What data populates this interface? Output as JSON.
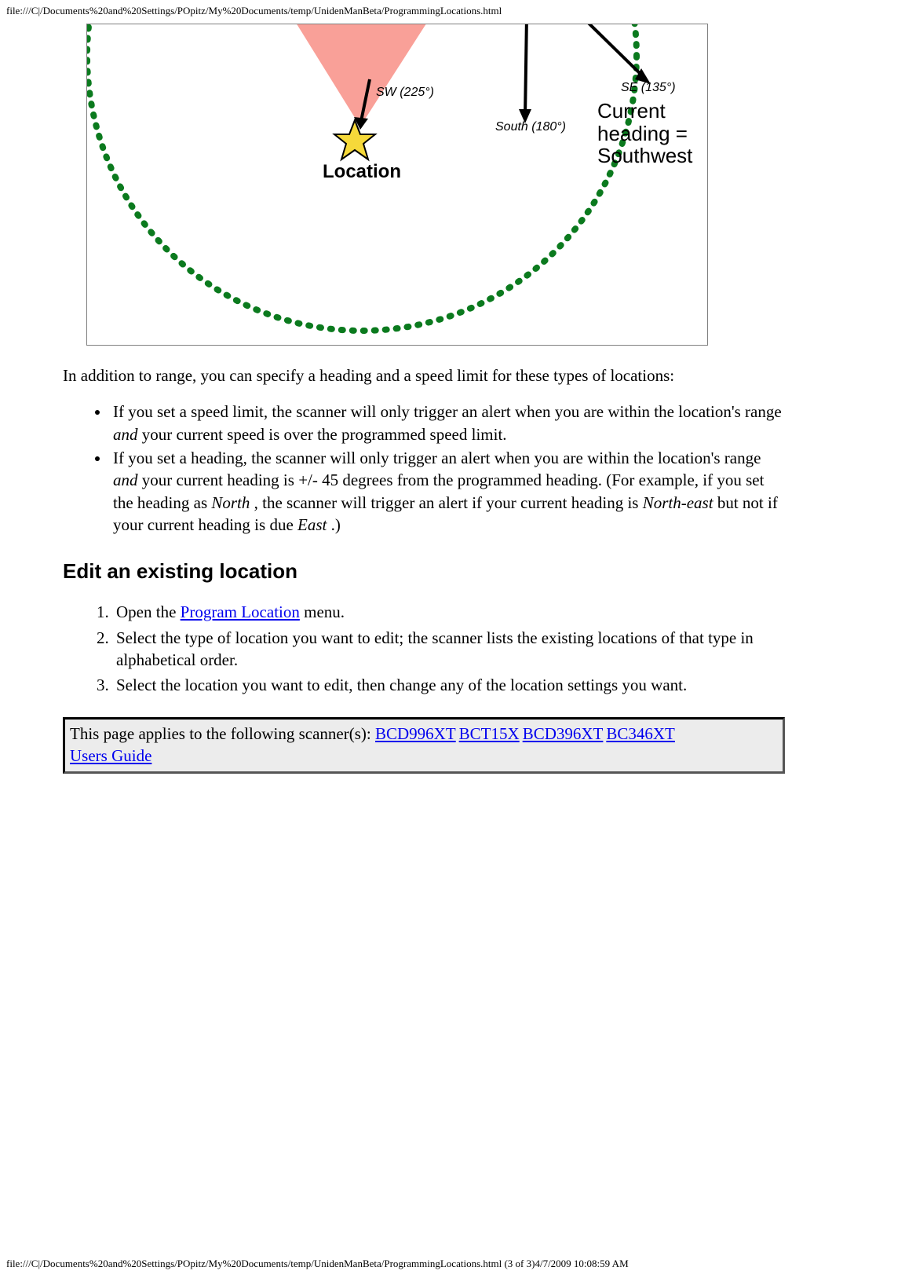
{
  "header_path": "file:///C|/Documents%20and%20Settings/POpitz/My%20Documents/temp/UnidenManBeta/ProgrammingLocations.html",
  "footer_path": "file:///C|/Documents%20and%20Settings/POpitz/My%20Documents/temp/UnidenManBeta/ProgrammingLocations.html (3 of 3)4/7/2009 10:08:59 AM",
  "diagram": {
    "label_sw": "SW (225°)",
    "label_south": "South (180°)",
    "label_se": "SE (135°)",
    "label_location": "Location",
    "current_heading_line1": "Current",
    "current_heading_line2": "heading =",
    "current_heading_line3": "Southwest"
  },
  "intro": "In addition to range, you can specify a heading and a speed limit for these types of locations:",
  "bullets": {
    "b1_a": "If you set a speed limit, the scanner will only trigger an alert when you are within the location's range ",
    "b1_em": "and",
    "b1_b": " your current speed is over the programmed speed limit.",
    "b2_a": "If you set a heading, the scanner will only trigger an alert when you are within the location's range ",
    "b2_em1": "and",
    "b2_b": " your current heading is +/- 45 degrees from the programmed heading. (For example, if you set the heading as ",
    "b2_em2": "North",
    "b2_c": " , the scanner will trigger an alert if your current heading is ",
    "b2_em3": "North-east",
    "b2_d": " but not if your current heading is due ",
    "b2_em4": "East",
    "b2_e": " .)"
  },
  "section_heading": "Edit an existing location",
  "steps": {
    "s1_a": "Open the ",
    "s1_link": "Program Location",
    "s1_b": " menu.",
    "s2": "Select the type of location you want to edit; the scanner lists the existing locations of that type in alphabetical order.",
    "s3": "Select the location you want to edit, then change any of the location settings you want."
  },
  "applies": {
    "prefix": "This page applies to the following scanner(s): ",
    "links": [
      "BCD996XT",
      "BCT15X",
      "BCD396XT",
      "BC346XT",
      "Users Guide"
    ]
  }
}
